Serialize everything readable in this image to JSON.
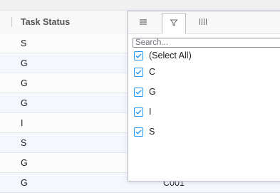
{
  "grid": {
    "header": {
      "label": "Task Status"
    },
    "rows": [
      {
        "status": "S",
        "extra": ""
      },
      {
        "status": "G",
        "extra": ""
      },
      {
        "status": "G",
        "extra": ""
      },
      {
        "status": "G",
        "extra": ""
      },
      {
        "status": "I",
        "extra": ""
      },
      {
        "status": "S",
        "extra": ""
      },
      {
        "status": "G",
        "extra": ""
      },
      {
        "status": "G",
        "extra": "C001"
      }
    ]
  },
  "filter_popup": {
    "tabs": [
      {
        "icon": "menu-icon"
      },
      {
        "icon": "filter-icon",
        "active": true
      },
      {
        "icon": "columns-icon"
      }
    ],
    "search": {
      "placeholder": "Search...",
      "value": ""
    },
    "options": [
      {
        "label": "(Select All)",
        "checked": true
      },
      {
        "label": "C",
        "checked": true
      },
      {
        "label": "G",
        "checked": true
      },
      {
        "label": "I",
        "checked": true
      },
      {
        "label": "S",
        "checked": true
      }
    ]
  },
  "colors": {
    "accent": "#2196f3",
    "border": "#dde2eb",
    "text": "#181d1f"
  }
}
